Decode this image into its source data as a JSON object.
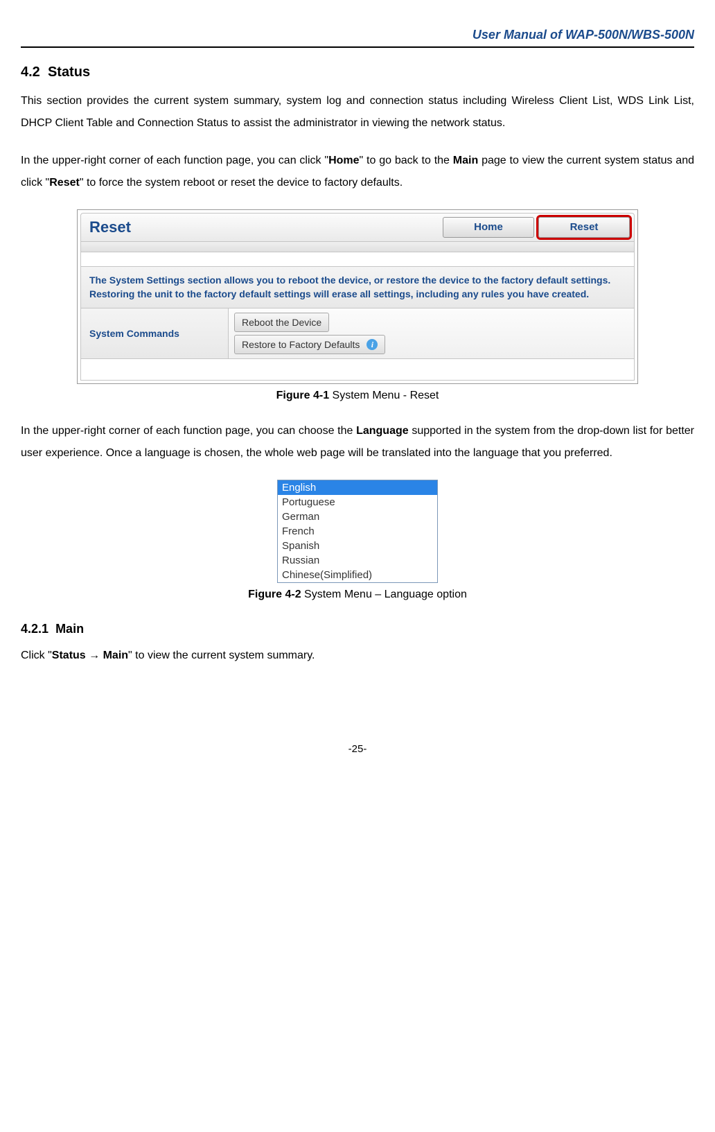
{
  "header": {
    "title": "User Manual of WAP-500N/WBS-500N"
  },
  "section": {
    "number": "4.2",
    "title": "Status"
  },
  "para1": "This section provides the current system summary, system log and connection status including Wireless Client List, WDS Link List, DHCP Client Table and Connection Status to assist the administrator in viewing the network status.",
  "para2": {
    "pre": "In the upper-right corner of each function page, you can click \"",
    "home": "Home",
    "mid1": "\" to go back to the ",
    "main": "Main",
    "mid2": " page to view the current system status and click \"",
    "reset": "Reset",
    "post": "\" to force the system reboot or reset the device to factory defaults."
  },
  "figure1": {
    "panel_title": "Reset",
    "home_btn": "Home",
    "reset_btn": "Reset",
    "description": "The System Settings section allows you to reboot the device, or restore the device to the factory default settings. Restoring the unit to the factory default settings will erase all settings, including any rules you have created.",
    "cmd_label": "System Commands",
    "reboot_btn": "Reboot the Device",
    "restore_btn": "Restore to Factory Defaults"
  },
  "caption1": {
    "label": "Figure 4-1",
    "text": " System Menu - Reset"
  },
  "para3": {
    "pre": "In the upper-right corner of each function page, you can choose the ",
    "lang": "Language",
    "post": " supported in the system from the drop-down list for better user experience. Once a language is chosen, the whole web page will be translated into the language that you preferred."
  },
  "figure2": {
    "languages": [
      "English",
      "Portuguese",
      "German",
      "French",
      "Spanish",
      "Russian",
      "Chinese(Simplified)"
    ]
  },
  "caption2": {
    "label": "Figure 4-2",
    "text": " System Menu – Language option"
  },
  "subsection": {
    "number": "4.2.1",
    "title": "Main"
  },
  "para4": {
    "pre": "Click \"",
    "path": "Status → Main",
    "post": "\" to view the current system summary."
  },
  "page_number": "-25-"
}
